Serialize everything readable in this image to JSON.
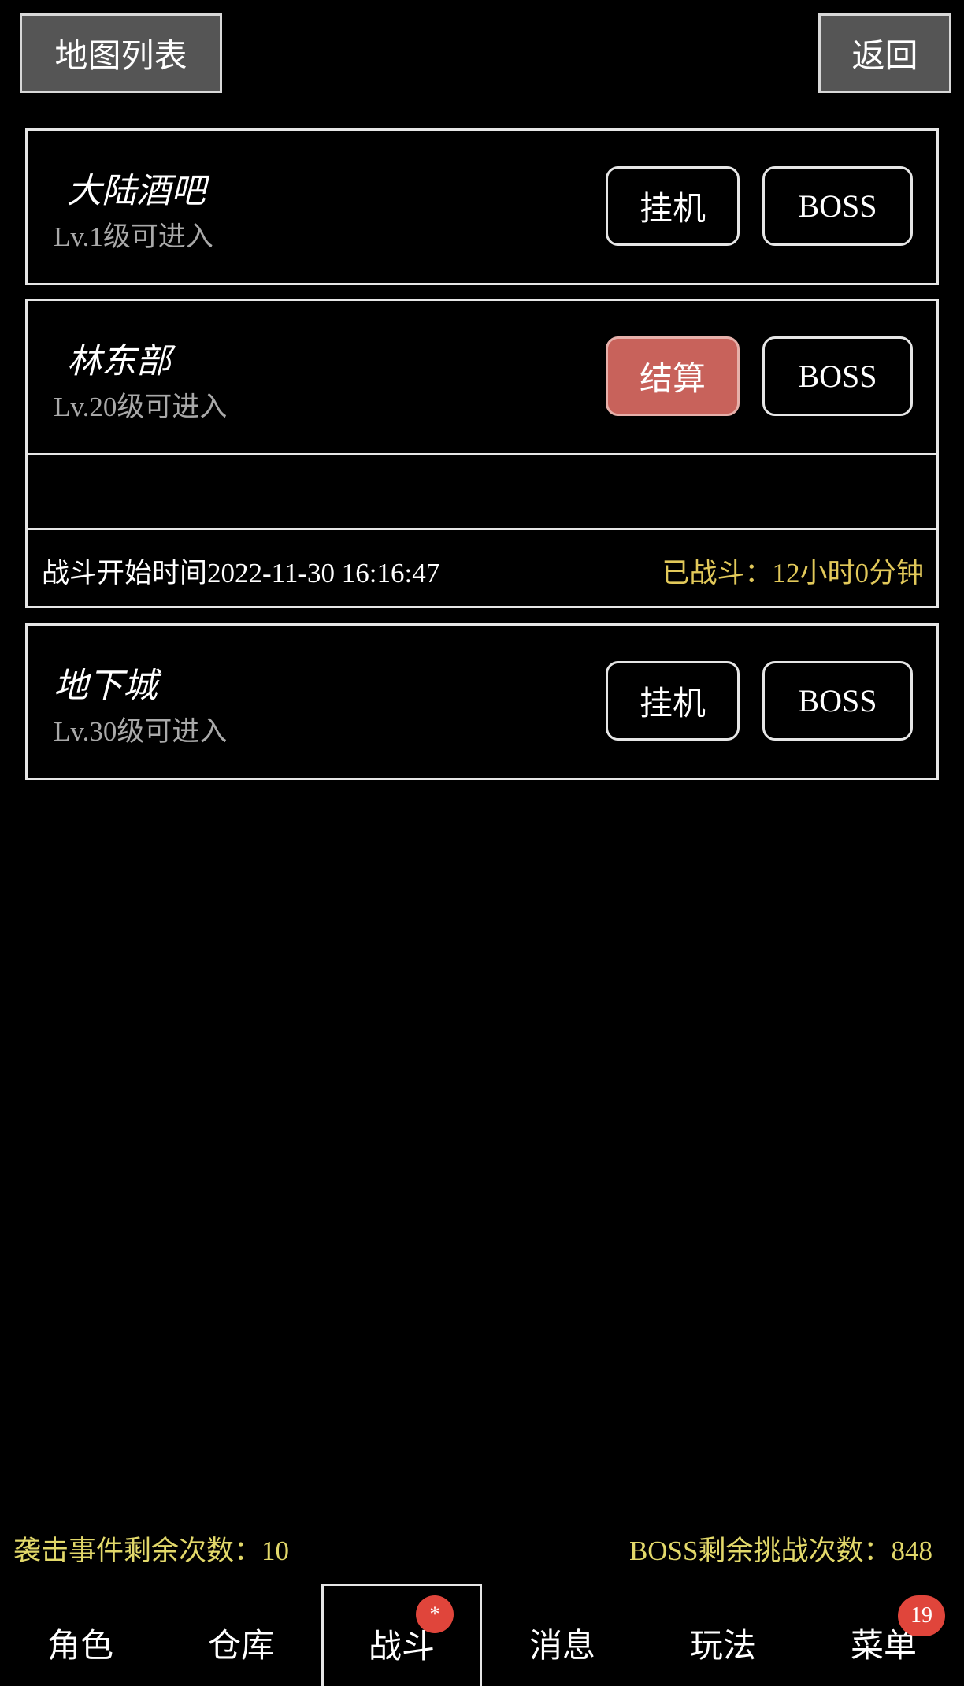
{
  "header": {
    "title_button": "地图列表",
    "back_button": "返回"
  },
  "maps": [
    {
      "name": "大陆酒吧",
      "level": "Lv.1级可进入",
      "primary_action": "挂机",
      "boss_action": "BOSS"
    },
    {
      "name": "林东部",
      "level": "Lv.20级可进入",
      "primary_action": "结算",
      "boss_action": "BOSS",
      "battle_start": "战斗开始时间2022-11-30 16:16:47",
      "battle_elapsed": "已战斗：12小时0分钟"
    },
    {
      "name": "地下城",
      "level": "Lv.30级可进入",
      "primary_action": "挂机",
      "boss_action": "BOSS"
    }
  ],
  "footer": {
    "raid_remaining": "袭击事件剩余次数：10",
    "boss_remaining": "BOSS剩余挑战次数：848"
  },
  "tabs": [
    {
      "label": "角色"
    },
    {
      "label": "仓库"
    },
    {
      "label": "战斗",
      "badge": "*",
      "active": true
    },
    {
      "label": "消息"
    },
    {
      "label": "玩法"
    },
    {
      "label": "菜单",
      "badge": "19"
    }
  ],
  "colors": {
    "background": "#000000",
    "settle_button": "#c8625b",
    "highlight_text": "#e2c95a",
    "badge": "#e0453b"
  }
}
